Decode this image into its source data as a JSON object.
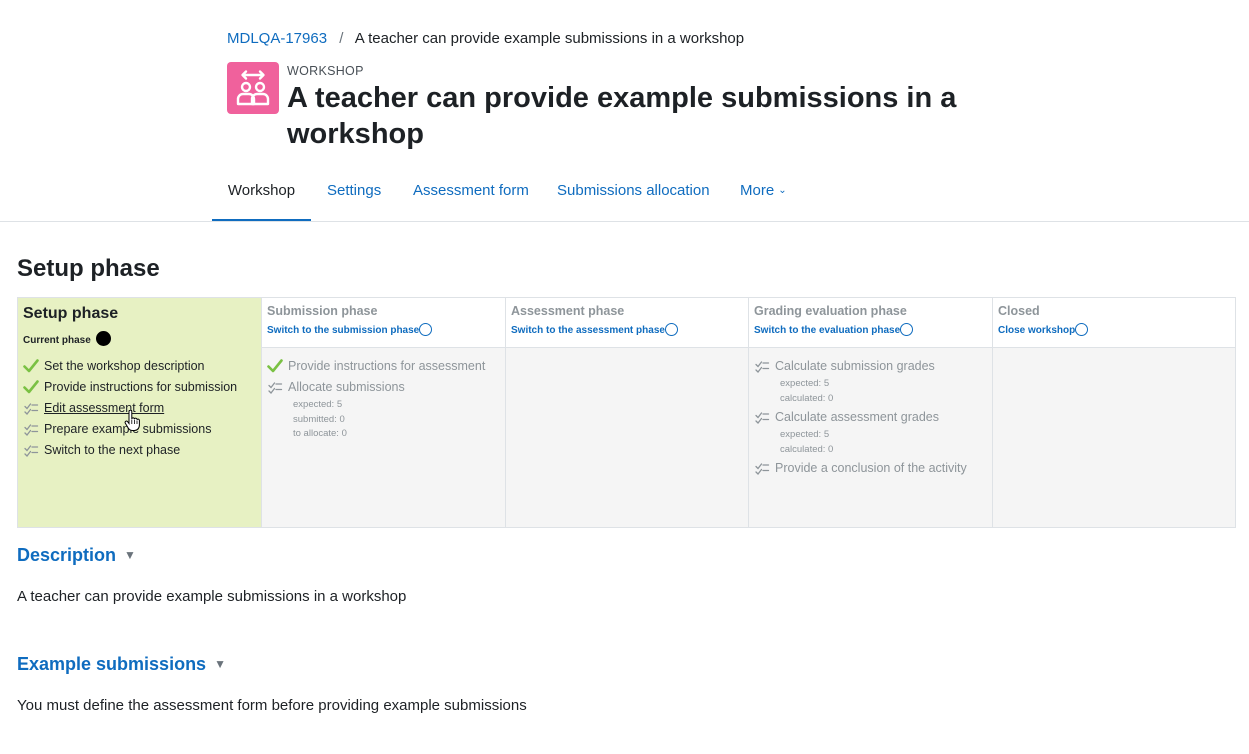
{
  "breadcrumb": {
    "parent": "MDLQA-17963",
    "separator": "/",
    "current": "A teacher can provide example submissions in a workshop"
  },
  "activity": {
    "type": "WORKSHOP",
    "title": "A teacher can provide example submissions in a workshop",
    "icon": "workshop-icon",
    "icon_color": "#f0619c"
  },
  "nav": {
    "tabs": [
      "Workshop",
      "Settings",
      "Assessment form",
      "Submissions allocation",
      "More"
    ],
    "active": "Workshop"
  },
  "phase_heading": "Setup phase",
  "planner": {
    "setup": {
      "title": "Setup phase",
      "status": "Current phase",
      "tasks": [
        {
          "label": "Set the workshop description",
          "state": "done"
        },
        {
          "label": "Provide instructions for submission",
          "state": "done"
        },
        {
          "label": "Edit assessment form",
          "state": "todo"
        },
        {
          "label": "Prepare example submissions",
          "state": "todo"
        },
        {
          "label": "Switch to the next phase",
          "state": "todo"
        }
      ]
    },
    "submission": {
      "title": "Submission phase",
      "action": "Switch to the submission phase",
      "tasks": [
        {
          "label": "Provide instructions for assessment",
          "state": "done"
        },
        {
          "label": "Allocate submissions",
          "state": "todo",
          "details": [
            "expected: 5",
            "submitted: 0",
            "to allocate: 0"
          ]
        }
      ]
    },
    "assessment": {
      "title": "Assessment phase",
      "action": "Switch to the assessment phase"
    },
    "grading": {
      "title": "Grading evaluation phase",
      "action": "Switch to the evaluation phase",
      "tasks": [
        {
          "label": "Calculate submission grades",
          "details": [
            "expected: 5",
            "calculated: 0"
          ]
        },
        {
          "label": "Calculate assessment grades",
          "details": [
            "expected: 5",
            "calculated: 0"
          ]
        },
        {
          "label": "Provide a conclusion of the activity"
        }
      ]
    },
    "closed": {
      "title": "Closed",
      "action": "Close workshop"
    }
  },
  "description": {
    "title": "Description",
    "text": "A teacher can provide example submissions in a workshop"
  },
  "example_submissions": {
    "title": "Example submissions",
    "text": "You must define the assessment form before providing example submissions"
  },
  "colors": {
    "link": "#0f6cbf",
    "active_phase_bg": "#e7f1c3",
    "check_green": "#7ac143"
  }
}
